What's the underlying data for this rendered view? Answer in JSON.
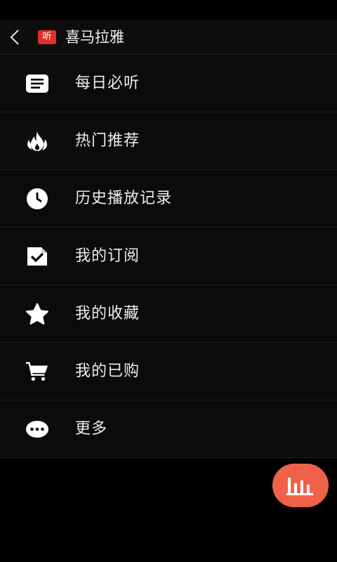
{
  "header": {
    "title": "喜马拉雅",
    "logo_text": "听"
  },
  "menu": {
    "items": [
      {
        "label": "每日必听",
        "icon": "list-icon"
      },
      {
        "label": "热门推荐",
        "icon": "fire-icon"
      },
      {
        "label": "历史播放记录",
        "icon": "clock-icon"
      },
      {
        "label": "我的订阅",
        "icon": "subscription-check-icon"
      },
      {
        "label": "我的收藏",
        "icon": "star-icon"
      },
      {
        "label": "我的已购",
        "icon": "cart-icon"
      },
      {
        "label": "更多",
        "icon": "more-dots-icon"
      }
    ]
  },
  "fab": {
    "icon": "playing-bars-icon",
    "color": "#f0614a"
  },
  "colors": {
    "background": "#000000",
    "accent": "#d9322a"
  }
}
